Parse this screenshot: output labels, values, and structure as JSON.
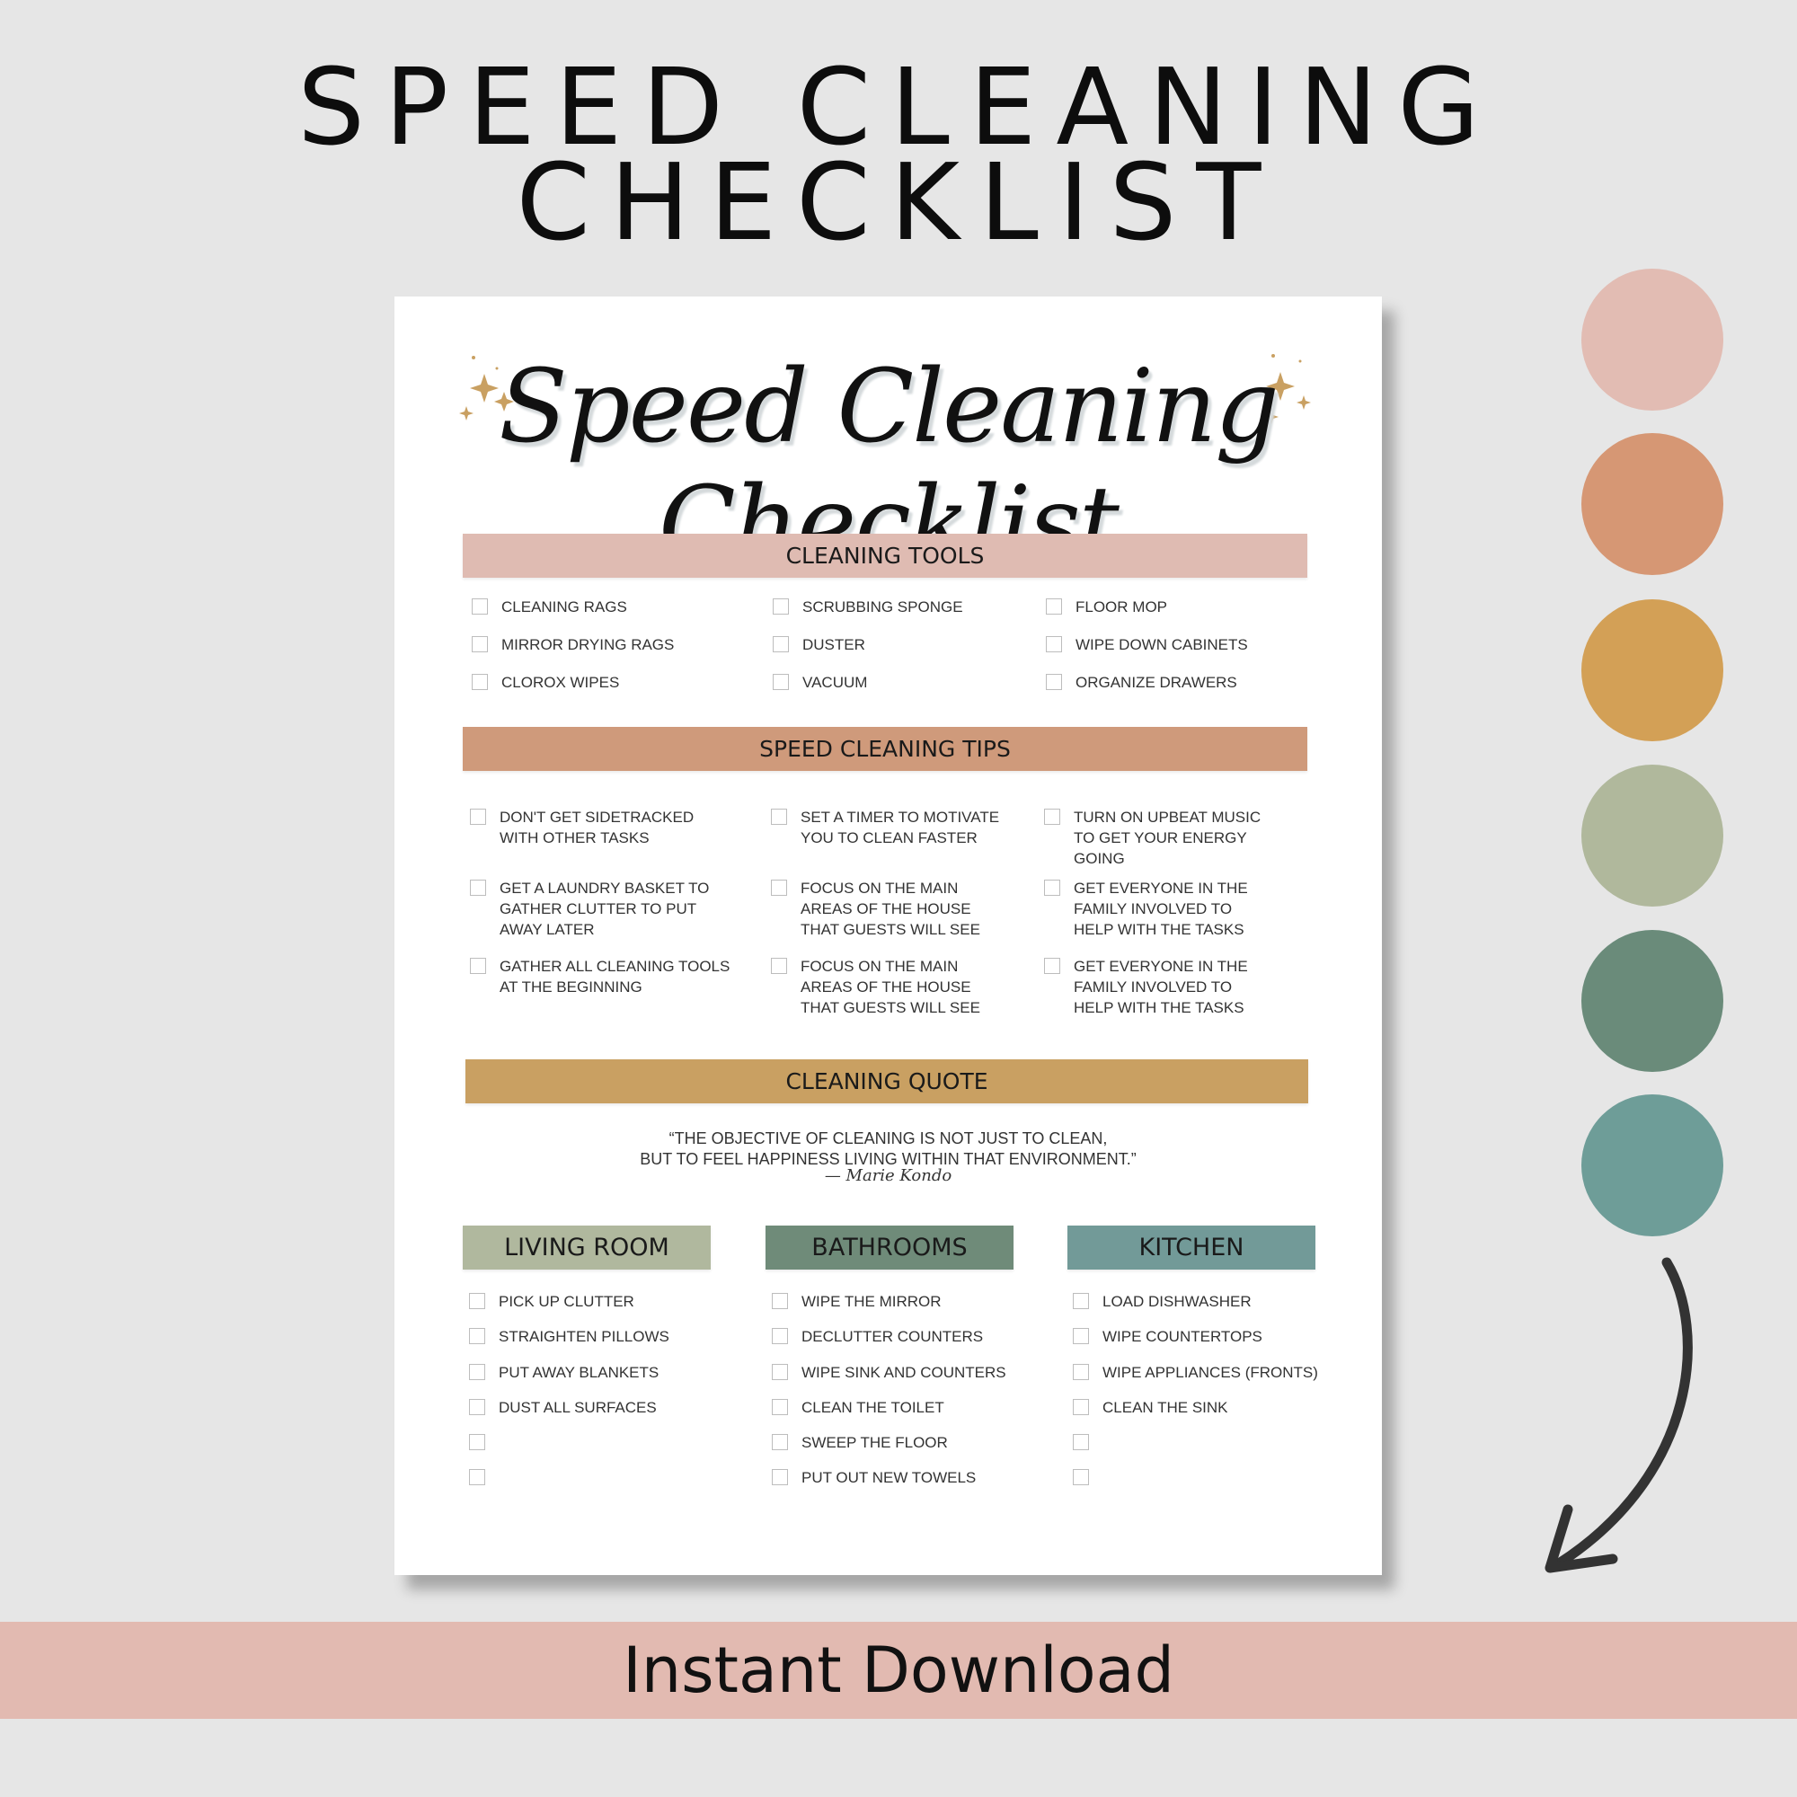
{
  "header": {
    "line1": "SPEED CLEANING",
    "line2": "CHECKLIST"
  },
  "printable": {
    "script_title": "Speed Cleaning Checklist",
    "sparkle_color": "#c9a062",
    "sections": {
      "tools": {
        "title": "CLEANING TOOLS",
        "color": "#dfbbb2",
        "columns": [
          [
            "CLEANING RAGS",
            "MIRROR DRYING RAGS",
            "CLOROX WIPES"
          ],
          [
            "SCRUBBING SPONGE",
            "DUSTER",
            "VACUUM"
          ],
          [
            "FLOOR MOP",
            "WIPE DOWN CABINETS",
            "ORGANIZE DRAWERS"
          ]
        ]
      },
      "tips": {
        "title": "SPEED CLEANING TIPS",
        "color": "#cf9a7b",
        "columns": [
          [
            "DON'T GET SIDETRACKED\nWITH OTHER TASKS",
            "GET A LAUNDRY BASKET TO\nGATHER CLUTTER TO PUT\nAWAY LATER",
            "GATHER ALL CLEANING TOOLS\nAT THE BEGINNING"
          ],
          [
            "SET A TIMER TO MOTIVATE\nYOU TO CLEAN FASTER",
            "FOCUS ON THE MAIN\nAREAS OF THE HOUSE\nTHAT GUESTS WILL SEE",
            "FOCUS ON THE MAIN\nAREAS OF THE HOUSE\nTHAT GUESTS WILL SEE"
          ],
          [
            "TURN ON UPBEAT MUSIC\nTO GET YOUR ENERGY\nGOING",
            "GET EVERYONE IN THE\nFAMILY INVOLVED TO\nHELP WITH THE TASKS",
            "GET EVERYONE IN THE\nFAMILY INVOLVED TO\nHELP WITH THE TASKS"
          ]
        ]
      },
      "quote": {
        "title": "CLEANING QUOTE",
        "color": "#c9a062",
        "line1": "“THE OBJECTIVE OF CLEANING IS NOT JUST TO CLEAN,",
        "line2": "BUT TO FEEL HAPPINESS LIVING WITHIN THAT ENVIRONMENT.”",
        "author": "— Marie Kondo"
      },
      "rooms": [
        {
          "title": "LIVING ROOM",
          "color": "#b0b89e",
          "items": [
            "PICK UP CLUTTER",
            "STRAIGHTEN PILLOWS",
            "PUT AWAY BLANKETS",
            "DUST ALL SURFACES",
            "",
            ""
          ]
        },
        {
          "title": "BATHROOMS",
          "color": "#6f8b79",
          "items": [
            "WIPE THE MIRROR",
            "DECLUTTER COUNTERS",
            "WIPE SINK AND COUNTERS",
            "CLEAN THE TOILET",
            "SWEEP THE FLOOR",
            "PUT OUT NEW TOWELS"
          ]
        },
        {
          "title": "KITCHEN",
          "color": "#729a98",
          "items": [
            "LOAD DISHWASHER",
            "WIPE COUNTERTOPS",
            "WIPE APPLIANCES (FRONTS)",
            "CLEAN THE SINK",
            "",
            ""
          ]
        }
      ]
    }
  },
  "palette": [
    "#e2bcb3",
    "#d69774",
    "#d3a056",
    "#b0b89c",
    "#6a8b7a",
    "#6e9d98"
  ],
  "arrow_icon": "curved-arrow-down-icon",
  "footer": {
    "label": "Instant Download"
  }
}
